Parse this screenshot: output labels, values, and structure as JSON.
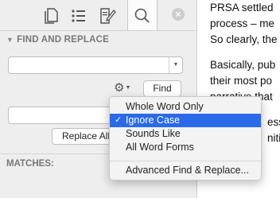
{
  "sidebar": {
    "tabs": [
      {
        "icon": "document-icon"
      },
      {
        "icon": "list-icon"
      },
      {
        "icon": "edit-icon"
      },
      {
        "icon": "search-icon",
        "active": true
      }
    ],
    "close_label": "×",
    "find_replace_title": "FIND AND REPLACE",
    "find_input": {
      "value": "",
      "placeholder": ""
    },
    "find_button": "Find",
    "replace_input": {
      "value": "",
      "placeholder": ""
    },
    "replace_all_button": "Replace All",
    "matches_title": "MATCHES:"
  },
  "options_menu": {
    "items": [
      {
        "label": "Whole Word Only",
        "checked": false,
        "selected": false
      },
      {
        "label": "Ignore Case",
        "checked": true,
        "selected": true
      },
      {
        "label": "Sounds Like",
        "checked": false,
        "selected": false
      },
      {
        "label": "All Word Forms",
        "checked": false,
        "selected": false
      }
    ],
    "advanced": "Advanced Find & Replace...",
    "check_glyph": "✓"
  },
  "document": {
    "lines": [
      "PRSA settled",
      "process – me",
      "So clearly, the",
      "",
      "Basically, pub",
      "their most po",
      "narrative that",
      "",
      "essi",
      "niti"
    ]
  },
  "colors": {
    "accent": "#2a6ae8"
  }
}
